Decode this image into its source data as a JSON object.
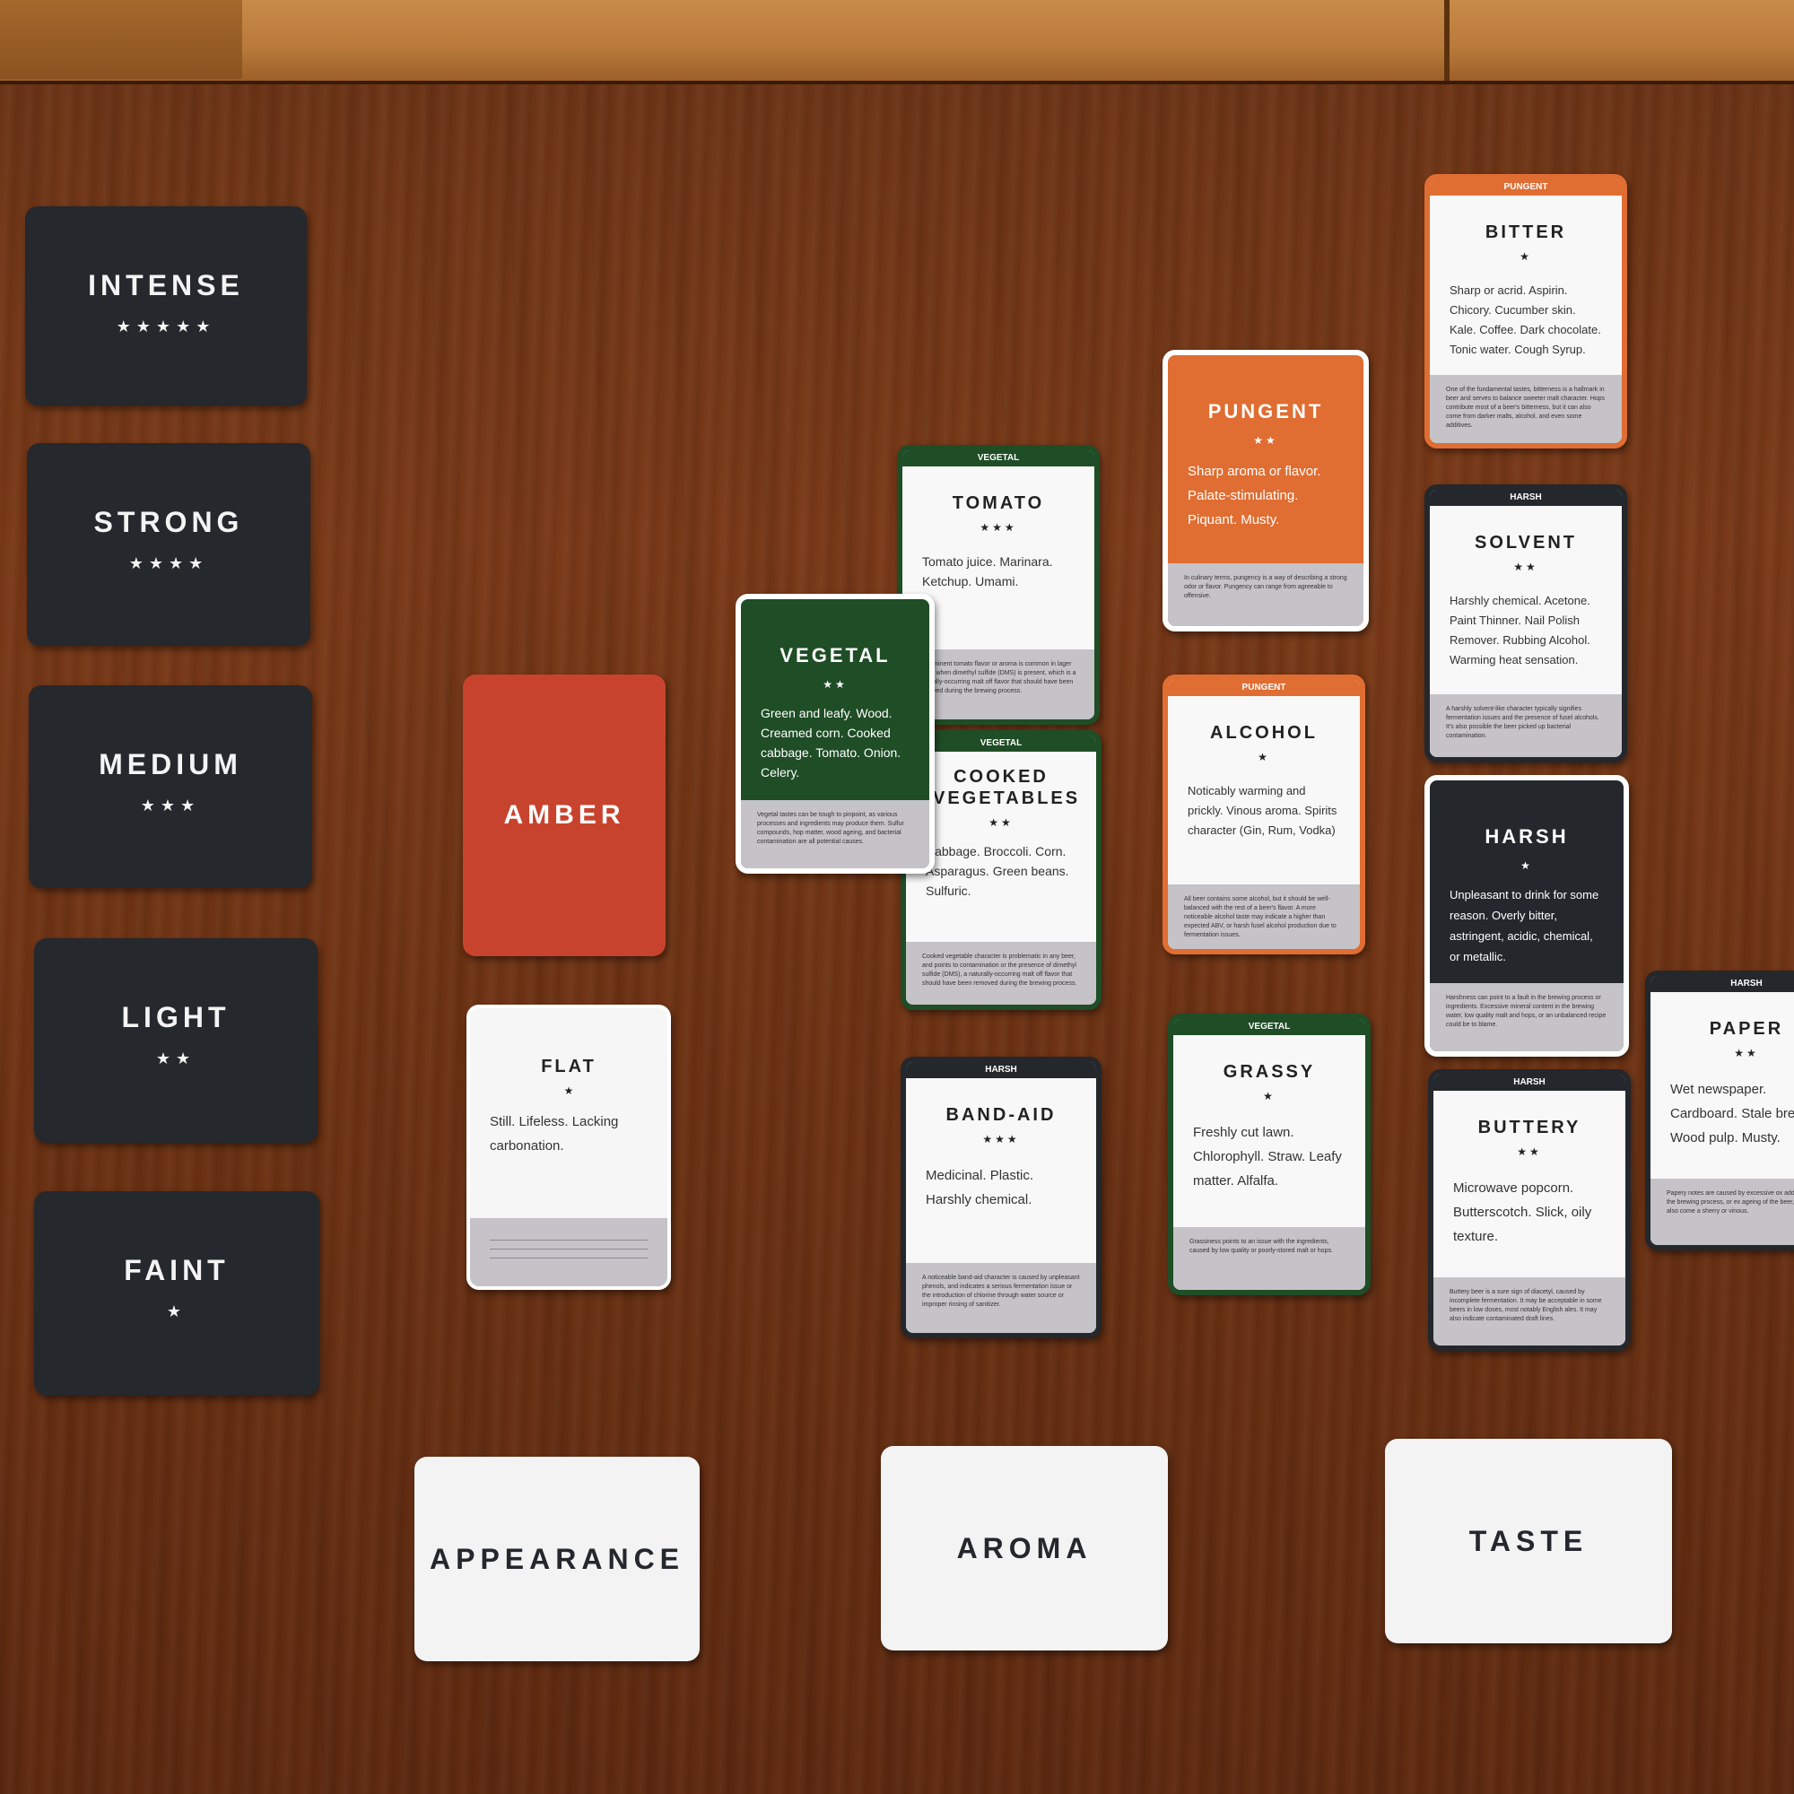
{
  "intensity_cards": [
    {
      "label": "INTENSE",
      "stars": "★★★★★"
    },
    {
      "label": "STRONG",
      "stars": "★★★★"
    },
    {
      "label": "MEDIUM",
      "stars": "★★★"
    },
    {
      "label": "LIGHT",
      "stars": "★★"
    },
    {
      "label": "FAINT",
      "stars": "★"
    }
  ],
  "categories": [
    "APPEARANCE",
    "AROMA",
    "TASTE"
  ],
  "amber": "AMBER",
  "flat": {
    "title": "FLAT",
    "stars": "★",
    "desc": "Still. Lifeless. Lacking carbonation."
  },
  "vegetal": {
    "title": "VEGETAL",
    "stars": "★★",
    "desc": "Green and leafy. Wood. Creamed corn. Cooked cabbage. Tomato. Onion. Celery.",
    "note": "Vegetal tastes can be tough to pinpoint, as various processes and ingredients may produce them. Sulfur compounds, hop matter, wood ageing, and bacterial contamination are all potential causes."
  },
  "tomato": {
    "tag": "VEGETAL",
    "title": "TOMATO",
    "stars": "★★★",
    "desc": "Tomato juice. Marinara. Ketchup. Umami.",
    "note": "A prominent tomato flavor or aroma is common in lager beers when dimethyl sulfide (DMS) is present, which is a naturally-occurring malt off flavor that should have been removed during the brewing process."
  },
  "cooked_veg": {
    "tag": "VEGETAL",
    "title": "COOKED VEGETABLES",
    "stars": "★★",
    "desc": "Cabbage. Broccoli. Corn. Asparagus. Green beans. Sulfuric.",
    "note": "Cooked vegetable character is problematic in any beer, and points to contamination or the presence of dimethyl sulfide (DMS), a naturally-occurring malt off flavor that should have been removed during the brewing process."
  },
  "pungent": {
    "title": "PUNGENT",
    "stars": "★★",
    "desc": "Sharp aroma or flavor. Palate-stimulating. Piquant. Musty.",
    "note": "In culinary terms, pungency is a way of describing a strong odor or flavor. Pungency can range from agreeable to offensive."
  },
  "alcohol": {
    "tag": "PUNGENT",
    "title": "ALCOHOL",
    "stars": "★",
    "desc": "Noticably warming and prickly. Vinous aroma. Spirits character (Gin, Rum, Vodka)",
    "note": "All beer contains some alcohol, but it should be well-balanced with the rest of a beer's flavor. A more noticeable alcohol taste may indicate a higher than expected ABV, or harsh fusel alcohol production due to fermentation issues."
  },
  "band_aid": {
    "tag": "HARSH",
    "title": "BAND-AID",
    "stars": "★★★",
    "desc": "Medicinal. Plastic. Harshly chemical.",
    "note": "A noticeable band-aid character is caused by unpleasant phenols, and indicates a serious fermentation issue or the introduction of chlorine through water source or improper rinsing of sanitizer."
  },
  "grassy": {
    "tag": "VEGETAL",
    "title": "GRASSY",
    "stars": "★",
    "desc": "Freshly cut lawn. Chlorophyll. Straw. Leafy matter. Alfalfa.",
    "note": "Grassiness points to an issue with the ingredients, caused by low quality or poorly-stored malt or hops."
  },
  "bitter": {
    "tag": "PUNGENT",
    "title": "BITTER",
    "stars": "★",
    "desc": "Sharp or acrid. Aspirin. Chicory. Cucumber skin. Kale. Coffee. Dark chocolate. Tonic water. Cough Syrup.",
    "note": "One of the fundamental tastes, bitterness is a hallmark in beer and serves to balance sweeter malt character. Hops contribute most of a beer's bitterness, but it can also come from darker malts, alcohol, and even some additives."
  },
  "solvent": {
    "tag": "HARSH",
    "title": "SOLVENT",
    "stars": "★★",
    "desc": "Harshly chemical. Acetone. Paint Thinner. Nail Polish Remover. Rubbing Alcohol. Warming heat sensation.",
    "note": "A harshly solvent-like character typically signifies fermentation issues and the presence of fusel alcohols. It's also possible the beer picked up bacterial contamination."
  },
  "harsh": {
    "title": "HARSH",
    "stars": "★",
    "desc": "Unpleasant to drink for some reason. Overly bitter, astringent, acidic, chemical, or metallic.",
    "note": "Harshness can point to a fault in the brewing process or ingredients. Excessive mineral content in the brewing water, low quality malt and hops, or an unbalanced recipe could be to blame."
  },
  "buttery": {
    "tag": "HARSH",
    "title": "BUTTERY",
    "stars": "★★",
    "desc": "Microwave popcorn. Butterscotch. Slick, oily texture.",
    "note": "Buttery beer is a sure sign of diacetyl, caused by incomplete fermentation. It may be acceptable in some beers in low doses, most notably English ales. It may also indicate contaminated draft lines."
  },
  "paper": {
    "tag": "HARSH",
    "title": "PAPER",
    "stars": "★★",
    "desc": "Wet newspaper. Cardboard. Stale bre Wood pulp. Musty.",
    "note": "Papery notes are caused by excessive ox added during the brewing process, or ex ageing of the beer, and can also come a sherry or vinous."
  }
}
